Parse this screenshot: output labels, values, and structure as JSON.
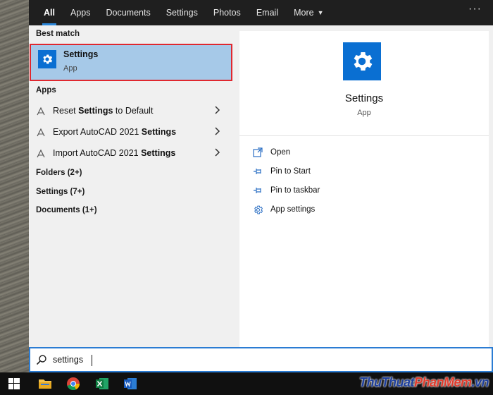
{
  "tabs": [
    {
      "label": "All",
      "active": true
    },
    {
      "label": "Apps"
    },
    {
      "label": "Documents"
    },
    {
      "label": "Settings"
    },
    {
      "label": "Photos"
    },
    {
      "label": "Email"
    },
    {
      "label": "More",
      "has_dropdown": true
    }
  ],
  "topbar": {
    "more_options": "···"
  },
  "left": {
    "best_match_label": "Best match",
    "best_match": {
      "title": "Settings",
      "subtitle": "App",
      "icon": "gear-icon"
    },
    "apps_label": "Apps",
    "apps": [
      {
        "pre": "Reset ",
        "bold": "Settings",
        "post": " to Default",
        "icon": "settings-shortcut-icon"
      },
      {
        "pre": "Export AutoCAD 2021 ",
        "bold": "Settings",
        "post": "",
        "icon": "settings-shortcut-icon"
      },
      {
        "pre": "Import AutoCAD 2021 ",
        "bold": "Settings",
        "post": "",
        "icon": "settings-shortcut-icon"
      }
    ],
    "groups": [
      {
        "label": "Folders (2+)"
      },
      {
        "label": "Settings (7+)"
      },
      {
        "label": "Documents (1+)"
      }
    ]
  },
  "right": {
    "title": "Settings",
    "subtitle": "App",
    "actions": [
      {
        "label": "Open",
        "icon": "open-icon"
      },
      {
        "label": "Pin to Start",
        "icon": "pin-icon"
      },
      {
        "label": "Pin to taskbar",
        "icon": "pin-icon"
      },
      {
        "label": "App settings",
        "icon": "gear-icon"
      }
    ]
  },
  "search": {
    "value": "settings",
    "icon": "search-icon"
  },
  "taskbar": {
    "icons": [
      "windows-start-icon",
      "file-explorer-icon",
      "chrome-icon",
      "excel-icon",
      "word-icon"
    ]
  },
  "watermark": {
    "part1": "ThuThuat",
    "part2": "PhanMem",
    "part3": ".vn"
  },
  "colors": {
    "accent": "#0a6fd2",
    "highlight": "#a6c9e8",
    "focus_outline": "#e0282f",
    "search_border": "#2b7cd3"
  }
}
